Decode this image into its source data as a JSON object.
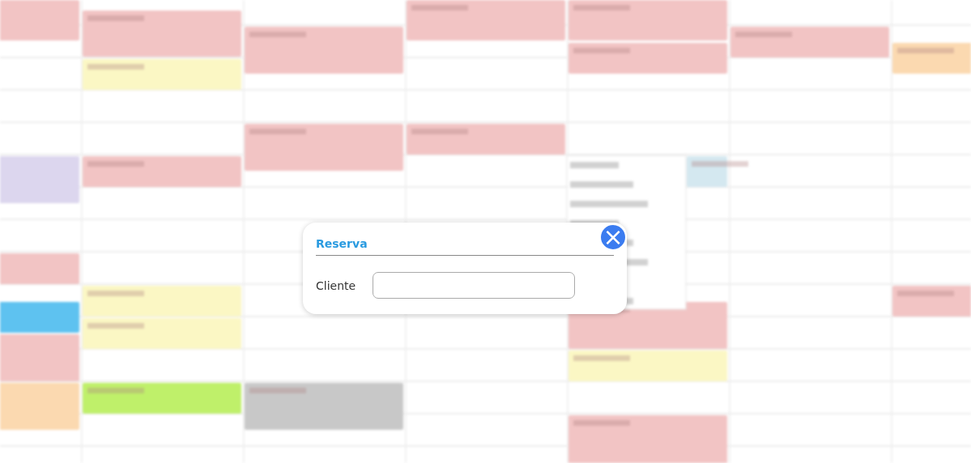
{
  "dialog": {
    "title": "Reserva",
    "close_label": "×",
    "fields": [
      {
        "label": "Cliente"
      }
    ]
  }
}
